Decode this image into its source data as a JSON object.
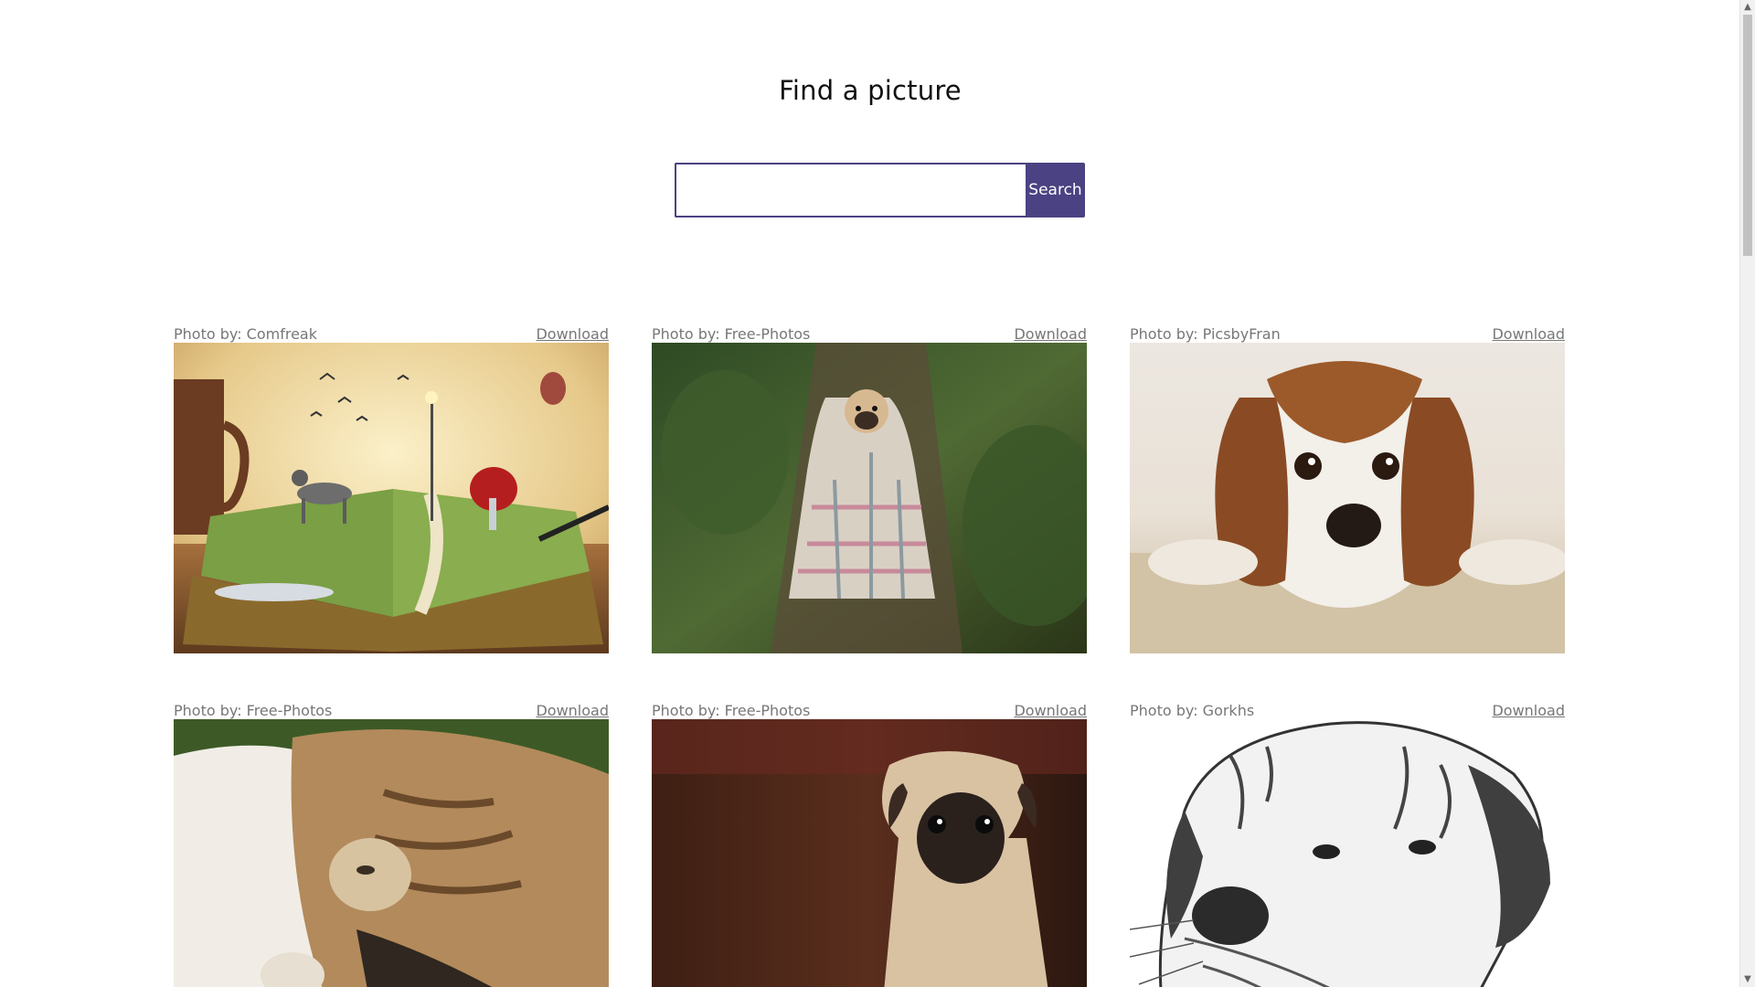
{
  "header": {
    "title": "Find a picture"
  },
  "search": {
    "value": "",
    "placeholder": "",
    "button_label": "Search"
  },
  "photos": [
    {
      "credit": "Photo by: Comfreak",
      "download_label": "Download",
      "subject": "book-with-dog-and-umbrella-girl"
    },
    {
      "credit": "Photo by: Free-Photos",
      "download_label": "Download",
      "subject": "pug-in-blanket"
    },
    {
      "credit": "Photo by: PicsbyFran",
      "download_label": "Download",
      "subject": "spaniel-puppy"
    },
    {
      "credit": "Photo by: Free-Photos",
      "download_label": "Download",
      "subject": "cat-and-dog"
    },
    {
      "credit": "Photo by: Free-Photos",
      "download_label": "Download",
      "subject": "pug-puppy"
    },
    {
      "credit": "Photo by: Gorkhs",
      "download_label": "Download",
      "subject": "dog-sketch"
    }
  ],
  "colors": {
    "accent": "#4a4282",
    "credit_text": "#777777"
  }
}
